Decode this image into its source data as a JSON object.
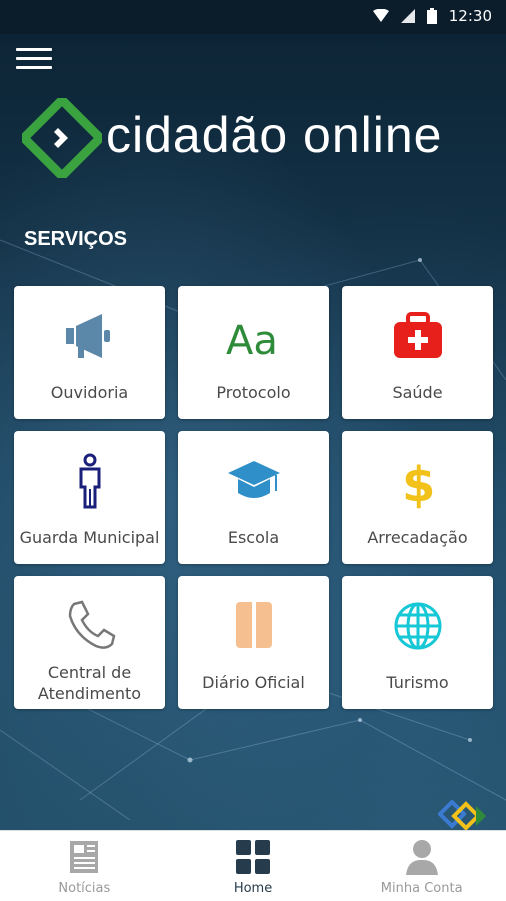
{
  "status_bar": {
    "time": "12:30"
  },
  "header": {
    "brand": "cidadão online"
  },
  "section": {
    "title": "SERVIÇOS"
  },
  "services": [
    {
      "label": "Ouvidoria",
      "icon": "megaphone-icon",
      "color": "#5b87a8"
    },
    {
      "label": "Protocolo",
      "icon": "font-aa-icon",
      "color": "#2e8b3a"
    },
    {
      "label": "Saúde",
      "icon": "first-aid-icon",
      "color": "#e8201b"
    },
    {
      "label": "Guarda Municipal",
      "icon": "person-icon",
      "color": "#1a1f7a"
    },
    {
      "label": "Escola",
      "icon": "graduation-cap-icon",
      "color": "#2f8fc8"
    },
    {
      "label": "Arrecadação",
      "icon": "dollar-icon",
      "color": "#f2c21b"
    },
    {
      "label": "Central de Atendimento",
      "icon": "phone-icon",
      "color": "#777777"
    },
    {
      "label": "Diário Oficial",
      "icon": "book-icon",
      "color": "#f6bf8f"
    },
    {
      "label": "Turismo",
      "icon": "globe-icon",
      "color": "#16c7d6"
    }
  ],
  "bottom_nav": [
    {
      "label": "Notícias",
      "icon": "newspaper-icon",
      "active": false
    },
    {
      "label": "Home",
      "icon": "grid-icon",
      "active": true
    },
    {
      "label": "Minha Conta",
      "icon": "user-icon",
      "active": false
    }
  ],
  "colors": {
    "accent_green": "#3aa340",
    "nav_active": "#263c4c"
  }
}
